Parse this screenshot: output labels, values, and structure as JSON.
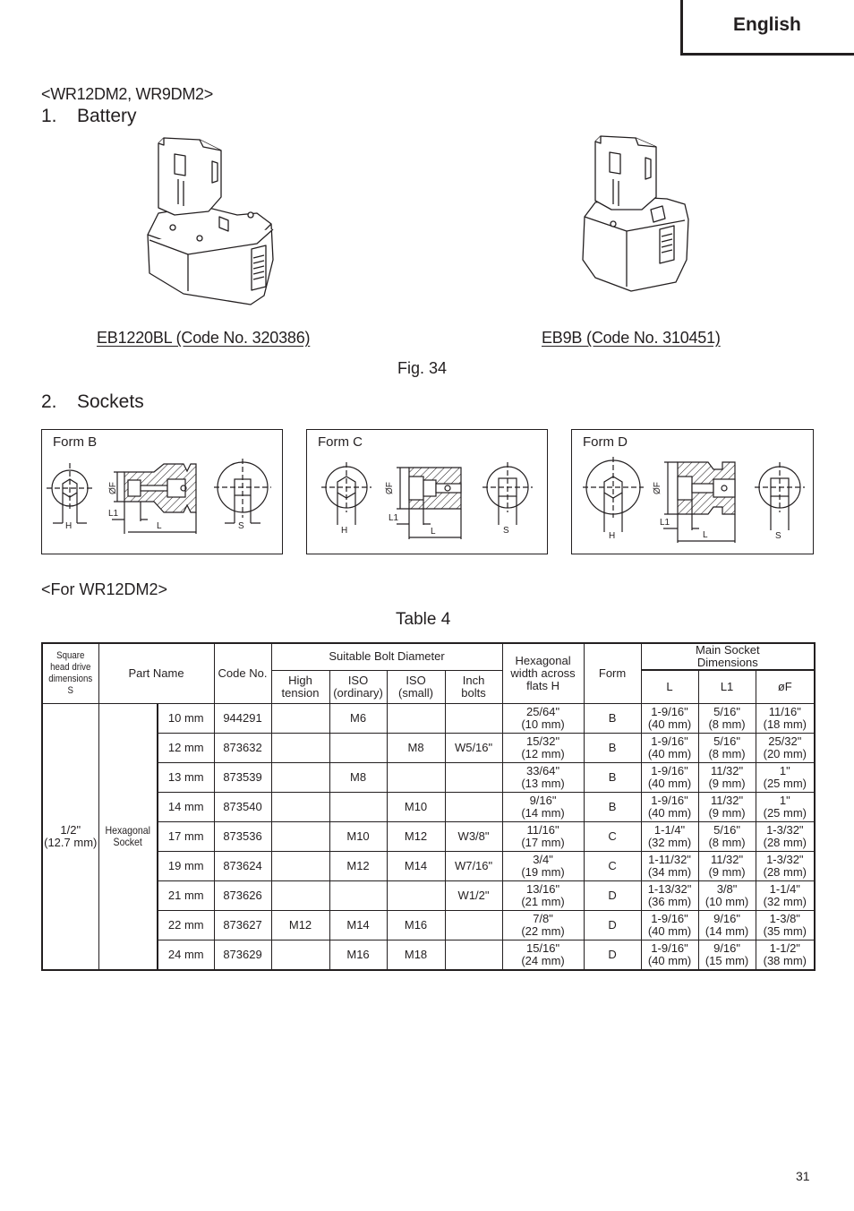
{
  "header": {
    "language": "English"
  },
  "models_heading": "<WR12DM2, WR9DM2>",
  "section1": {
    "number": "1.",
    "title": "Battery"
  },
  "batteries": [
    {
      "caption": "EB1220BL (Code No. 320386)",
      "icon": "battery-eb1220bl-illustration"
    },
    {
      "caption": "EB9B (Code No. 310451)",
      "icon": "battery-eb9b-illustration"
    }
  ],
  "figure_label": "Fig. 34",
  "section2": {
    "number": "2.",
    "title": "Sockets"
  },
  "socket_forms": [
    {
      "label": "Form B",
      "dims": {
        "h": "H",
        "f": "ØF",
        "l1": "L1",
        "l": "L",
        "s": "S"
      }
    },
    {
      "label": "Form C",
      "dims": {
        "h": "H",
        "f": "ØF",
        "l1": "L1",
        "l": "L",
        "s": "S"
      }
    },
    {
      "label": "Form D",
      "dims": {
        "h": "H",
        "f": "ØF",
        "l1": "L1",
        "l": "L",
        "s": "S"
      }
    }
  ],
  "for_model": "<For WR12DM2>",
  "table": {
    "title": "Table 4",
    "headers": {
      "square_drive": [
        "Square",
        "head drive",
        "dimensions S"
      ],
      "part_name": "Part Name",
      "code_no": "Code No.",
      "bolt_group": "Suitable Bolt Diameter",
      "high_tension": [
        "High",
        "tension"
      ],
      "iso_ordinary": [
        "ISO",
        "(ordinary)"
      ],
      "iso_small": [
        "ISO",
        "(small)"
      ],
      "inch_bolts": [
        "Inch",
        "bolts"
      ],
      "hex_width": [
        "Hexagonal",
        "width across",
        "flats H"
      ],
      "form": "Form",
      "main_dims": [
        "Main Socket",
        "Dimensions"
      ],
      "L": "L",
      "L1": "L1",
      "F": "øF"
    },
    "square_drive_value": [
      "1/2\"",
      "(12.7 mm)"
    ],
    "part_name_value": [
      "Hexagonal",
      "Socket"
    ],
    "rows": [
      {
        "size": "10 mm",
        "code": "944291",
        "high": "",
        "iso_ord": "M6",
        "iso_small": "",
        "inch": "",
        "hex": [
          "25/64\"",
          "(10 mm)"
        ],
        "form": "B",
        "L": [
          "1-9/16\"",
          "(40 mm)"
        ],
        "L1": [
          "5/16\"",
          "(8 mm)"
        ],
        "F": [
          "11/16\"",
          "(18 mm)"
        ]
      },
      {
        "size": "12 mm",
        "code": "873632",
        "high": "",
        "iso_ord": "",
        "iso_small": "M8",
        "inch": "W5/16\"",
        "hex": [
          "15/32\"",
          "(12 mm)"
        ],
        "form": "B",
        "L": [
          "1-9/16\"",
          "(40 mm)"
        ],
        "L1": [
          "5/16\"",
          "(8 mm)"
        ],
        "F": [
          "25/32\"",
          "(20 mm)"
        ]
      },
      {
        "size": "13 mm",
        "code": "873539",
        "high": "",
        "iso_ord": "M8",
        "iso_small": "",
        "inch": "",
        "hex": [
          "33/64\"",
          "(13 mm)"
        ],
        "form": "B",
        "L": [
          "1-9/16\"",
          "(40 mm)"
        ],
        "L1": [
          "11/32\"",
          "(9 mm)"
        ],
        "F": [
          "1\"",
          "(25 mm)"
        ]
      },
      {
        "size": "14 mm",
        "code": "873540",
        "high": "",
        "iso_ord": "",
        "iso_small": "M10",
        "inch": "",
        "hex": [
          "9/16\"",
          "(14 mm)"
        ],
        "form": "B",
        "L": [
          "1-9/16\"",
          "(40 mm)"
        ],
        "L1": [
          "11/32\"",
          "(9 mm)"
        ],
        "F": [
          "1\"",
          "(25 mm)"
        ]
      },
      {
        "size": "17 mm",
        "code": "873536",
        "high": "",
        "iso_ord": "M10",
        "iso_small": "M12",
        "inch": "W3/8\"",
        "hex": [
          "11/16\"",
          "(17 mm)"
        ],
        "form": "C",
        "L": [
          "1-1/4\"",
          "(32 mm)"
        ],
        "L1": [
          "5/16\"",
          "(8 mm)"
        ],
        "F": [
          "1-3/32\"",
          "(28 mm)"
        ]
      },
      {
        "size": "19 mm",
        "code": "873624",
        "high": "",
        "iso_ord": "M12",
        "iso_small": "M14",
        "inch": "W7/16\"",
        "hex": [
          "3/4\"",
          "(19 mm)"
        ],
        "form": "C",
        "L": [
          "1-11/32\"",
          "(34 mm)"
        ],
        "L1": [
          "11/32\"",
          "(9 mm)"
        ],
        "F": [
          "1-3/32\"",
          "(28 mm)"
        ]
      },
      {
        "size": "21 mm",
        "code": "873626",
        "high": "",
        "iso_ord": "",
        "iso_small": "",
        "inch": "W1/2\"",
        "hex": [
          "13/16\"",
          "(21 mm)"
        ],
        "form": "D",
        "L": [
          "1-13/32\"",
          "(36 mm)"
        ],
        "L1": [
          "3/8\"",
          "(10 mm)"
        ],
        "F": [
          "1-1/4\"",
          "(32 mm)"
        ]
      },
      {
        "size": "22 mm",
        "code": "873627",
        "high": "M12",
        "iso_ord": "M14",
        "iso_small": "M16",
        "inch": "",
        "hex": [
          "7/8\"",
          "(22 mm)"
        ],
        "form": "D",
        "L": [
          "1-9/16\"",
          "(40 mm)"
        ],
        "L1": [
          "9/16\"",
          "(14 mm)"
        ],
        "F": [
          "1-3/8\"",
          "(35 mm)"
        ]
      },
      {
        "size": "24 mm",
        "code": "873629",
        "high": "",
        "iso_ord": "M16",
        "iso_small": "M18",
        "inch": "",
        "hex": [
          "15/16\"",
          "(24 mm)"
        ],
        "form": "D",
        "L": [
          "1-9/16\"",
          "(40 mm)"
        ],
        "L1": [
          "9/16\"",
          "(15 mm)"
        ],
        "F": [
          "1-1/2\"",
          "(38 mm)"
        ]
      }
    ]
  },
  "page_number": "31"
}
